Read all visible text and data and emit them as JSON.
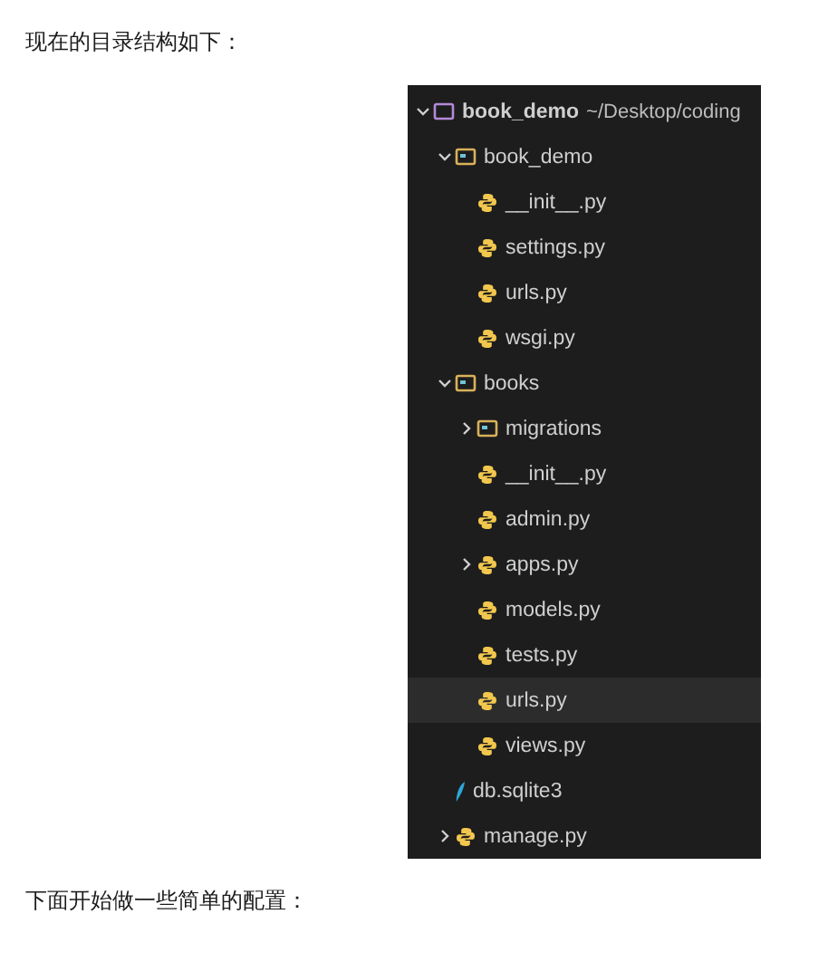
{
  "intro": "现在的目录结构如下：",
  "tree": {
    "name": "book_demo",
    "path": "~/Desktop/coding",
    "kind": "root",
    "expanded": true,
    "selected": false,
    "children": [
      {
        "name": "book_demo",
        "kind": "folder",
        "expanded": true,
        "selected": false,
        "children": [
          {
            "name": "__init__.py",
            "kind": "python",
            "selected": false
          },
          {
            "name": "settings.py",
            "kind": "python",
            "selected": false
          },
          {
            "name": "urls.py",
            "kind": "python",
            "selected": false
          },
          {
            "name": "wsgi.py",
            "kind": "python",
            "selected": false
          }
        ]
      },
      {
        "name": "books",
        "kind": "folder",
        "expanded": true,
        "selected": false,
        "children": [
          {
            "name": "migrations",
            "kind": "folder",
            "expanded": false,
            "selected": false
          },
          {
            "name": "__init__.py",
            "kind": "python",
            "selected": false
          },
          {
            "name": "admin.py",
            "kind": "python",
            "selected": false
          },
          {
            "name": "apps.py",
            "kind": "python",
            "expanded": false,
            "selected": false
          },
          {
            "name": "models.py",
            "kind": "python",
            "selected": false
          },
          {
            "name": "tests.py",
            "kind": "python",
            "selected": false
          },
          {
            "name": "urls.py",
            "kind": "python",
            "selected": true
          },
          {
            "name": "views.py",
            "kind": "python",
            "selected": false
          }
        ]
      },
      {
        "name": "db.sqlite3",
        "kind": "database",
        "selected": false
      },
      {
        "name": "manage.py",
        "kind": "python",
        "expanded": false,
        "selected": false
      }
    ]
  },
  "outro": "下面开始做一些简单的配置："
}
